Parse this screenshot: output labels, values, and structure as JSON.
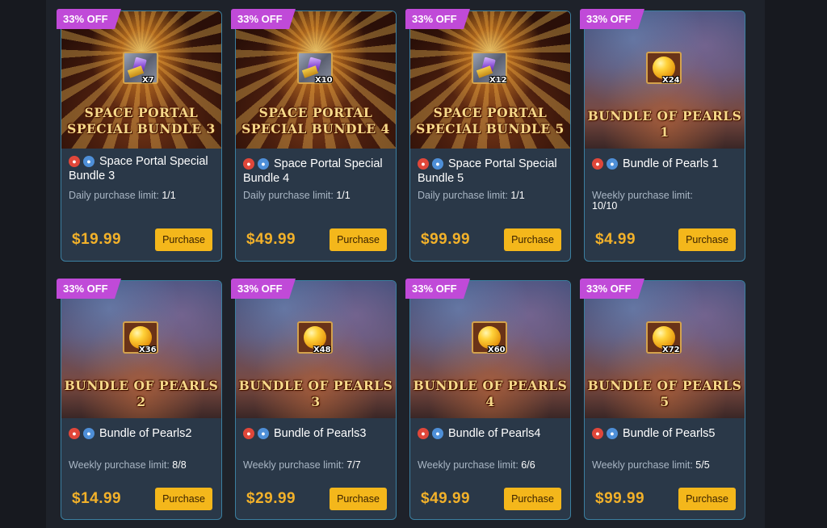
{
  "colors": {
    "badge": "#c04ad8",
    "price": "#f2b12a",
    "button": "#f4b71b",
    "card_border": "#3b7fa0"
  },
  "cards": [
    {
      "badge": "33% OFF",
      "art_title_1": "SPACE PORTAL",
      "art_title_2": "SPECIAL BUNDLE 3",
      "art_type": "portal",
      "quantity": "X7",
      "name": "Space Portal Special Bundle 3",
      "limit_label": "Daily purchase limit:",
      "limit_value": "1/1",
      "price": "$19.99",
      "button_label": "Purchase"
    },
    {
      "badge": "33% OFF",
      "art_title_1": "SPACE PORTAL",
      "art_title_2": "SPECIAL BUNDLE 4",
      "art_type": "portal",
      "quantity": "X10",
      "name": "Space Portal Special Bundle 4",
      "limit_label": "Daily purchase limit:",
      "limit_value": "1/1",
      "price": "$49.99",
      "button_label": "Purchase"
    },
    {
      "badge": "33% OFF",
      "art_title_1": "SPACE PORTAL",
      "art_title_2": "SPECIAL BUNDLE 5",
      "art_type": "portal",
      "quantity": "X12",
      "name": "Space Portal Special Bundle 5",
      "limit_label": "Daily purchase limit:",
      "limit_value": "1/1",
      "price": "$99.99",
      "button_label": "Purchase"
    },
    {
      "badge": "33% OFF",
      "art_title_1": "BUNDLE OF PEARLS 1",
      "art_title_2": "",
      "art_type": "pearl",
      "quantity": "X24",
      "name": "Bundle of Pearls 1",
      "limit_label": "Weekly purchase limit:",
      "limit_value": "10/10",
      "price": "$4.99",
      "button_label": "Purchase"
    },
    {
      "badge": "33% OFF",
      "art_title_1": "BUNDLE OF PEARLS 2",
      "art_title_2": "",
      "art_type": "pearl",
      "quantity": "X36",
      "name": "Bundle of Pearls2",
      "limit_label": "Weekly purchase limit:",
      "limit_value": "8/8",
      "price": "$14.99",
      "button_label": "Purchase"
    },
    {
      "badge": "33% OFF",
      "art_title_1": "BUNDLE OF PEARLS 3",
      "art_title_2": "",
      "art_type": "pearl",
      "quantity": "X48",
      "name": "Bundle of Pearls3",
      "limit_label": "Weekly purchase limit:",
      "limit_value": "7/7",
      "price": "$29.99",
      "button_label": "Purchase"
    },
    {
      "badge": "33% OFF",
      "art_title_1": "BUNDLE OF PEARLS 4",
      "art_title_2": "",
      "art_type": "pearl",
      "quantity": "X60",
      "name": "Bundle of Pearls4",
      "limit_label": "Weekly purchase limit:",
      "limit_value": "6/6",
      "price": "$49.99",
      "button_label": "Purchase"
    },
    {
      "badge": "33% OFF",
      "art_title_1": "BUNDLE OF PEARLS 5",
      "art_title_2": "",
      "art_type": "pearl",
      "quantity": "X72",
      "name": "Bundle of Pearls5",
      "limit_label": "Weekly purchase limit:",
      "limit_value": "5/5",
      "price": "$99.99",
      "button_label": "Purchase"
    }
  ]
}
